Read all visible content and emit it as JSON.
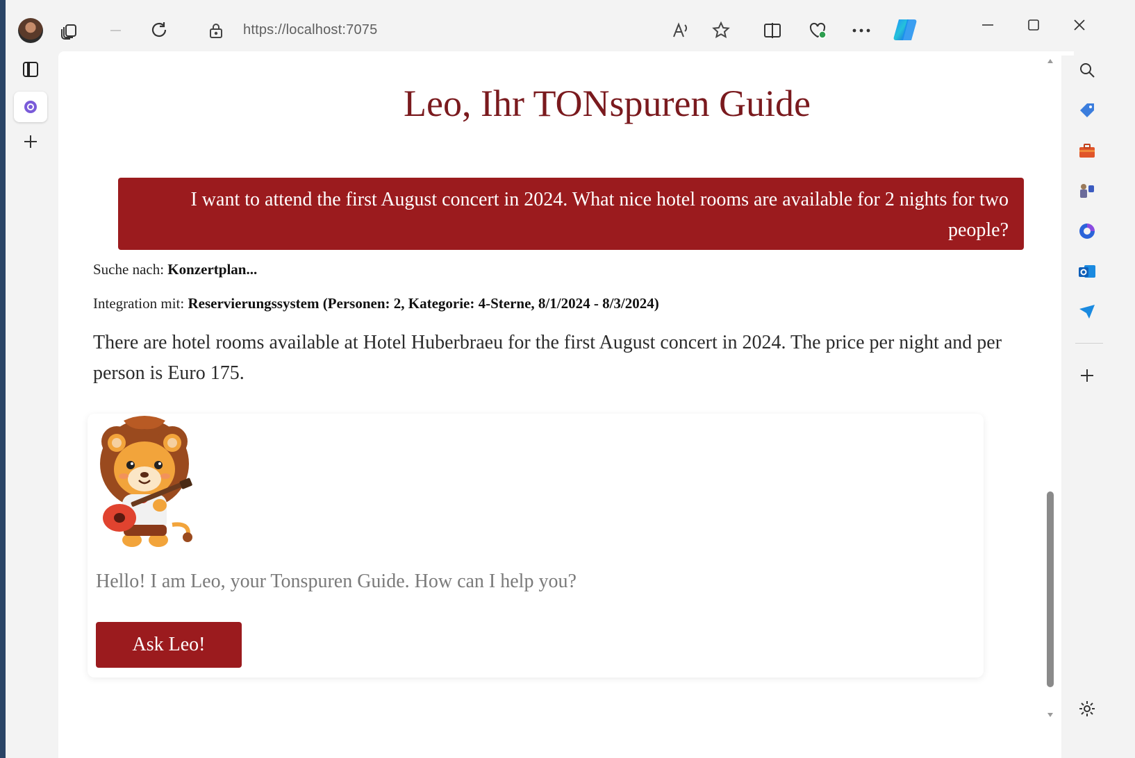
{
  "browser": {
    "url": "https://localhost:7075",
    "icons": {
      "profile": "avatar",
      "tabs": "tab-actions-icon",
      "back": "back-arrow-icon",
      "refresh": "refresh-icon",
      "lock": "lock-icon",
      "read_aloud": "read-aloud-icon",
      "favorite": "star-icon",
      "split_screen": "split-screen-icon",
      "health": "browser-essentials-icon",
      "more": "more-icon",
      "copilot": "copilot-icon",
      "minimize": "minimize-icon",
      "maximize": "maximize-icon",
      "close": "close-icon"
    }
  },
  "vertical_tabs": {
    "icons": [
      "sidebar-toggle-icon",
      "tab-favicon-icon",
      "new-tab-plus-icon"
    ]
  },
  "page": {
    "title": "Leo, Ihr TONspuren Guide",
    "user_message": "I want to attend the first August concert in 2024. What nice hotel rooms are available for 2 nights for two people?",
    "search_label": "Suche nach: ",
    "search_value": "Konzertplan...",
    "integration_label": "Integration mit: ",
    "integration_value": "Reservierungssystem (Personen: 2, Kategorie: 4-Sterne, 8/1/2024 - 8/3/2024)",
    "answer": "There are hotel rooms available at Hotel Huberbraeu for the first August concert in 2024. The price per night and per person is Euro 175.",
    "input_placeholder": "Hello! I am Leo, your Tonspuren Guide. How can I help you?",
    "ask_button": "Ask Leo!"
  },
  "right_sidebar": {
    "icons": [
      "search-icon",
      "shopping-tag-icon",
      "tools-briefcase-icon",
      "games-icon",
      "microsoft365-icon",
      "outlook-icon",
      "drop-send-icon",
      "add-icon",
      "settings-icon"
    ]
  },
  "colors": {
    "accent": "#9b1b1e",
    "title": "#7a1a1e",
    "placeholder": "#7a7a7a"
  }
}
